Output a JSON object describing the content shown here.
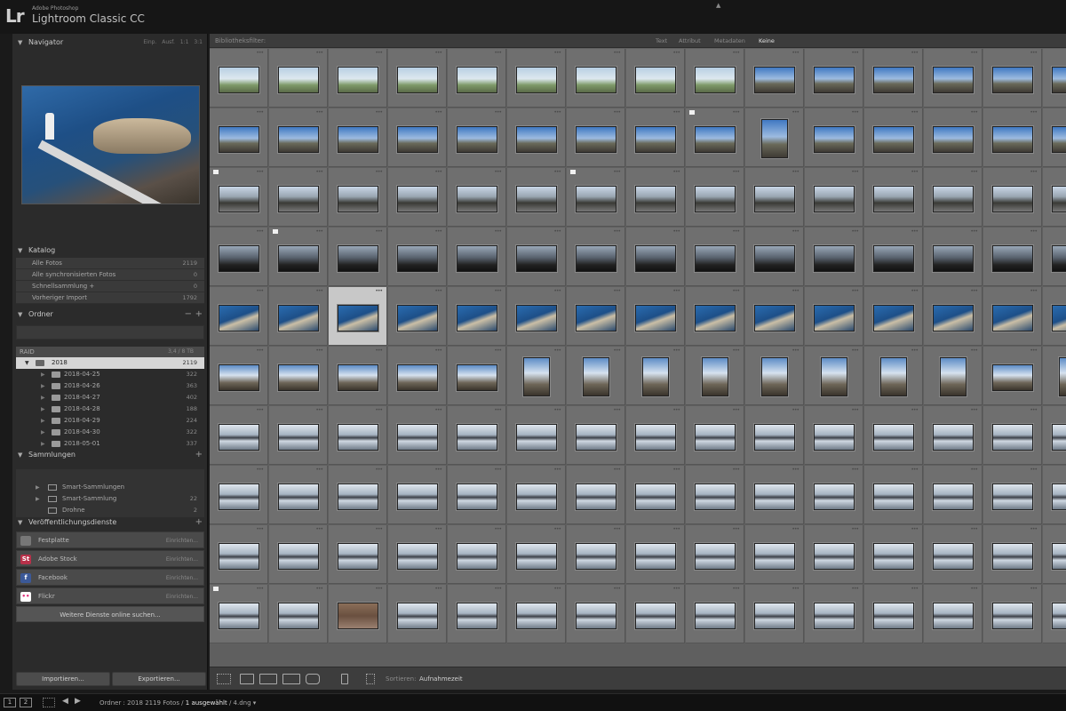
{
  "app": {
    "logo": "Lr",
    "brand_small": "Adobe Photoshop",
    "brand_title": "Lightroom Classic CC"
  },
  "navigator": {
    "title": "Navigator",
    "options": "Einp. Ausf. 1:1 3:1"
  },
  "catalog": {
    "title": "Katalog",
    "rows": [
      {
        "label": "Alle Fotos",
        "count": "2119"
      },
      {
        "label": "Alle synchronisierten Fotos",
        "count": "0"
      },
      {
        "label": "Schnellsammlung +",
        "count": "0"
      },
      {
        "label": "Vorheriger Import",
        "count": "1792"
      }
    ]
  },
  "folders": {
    "title": "Ordner",
    "volume": "RAID",
    "volume_info": "3,4 / 8 TB",
    "root": {
      "label": "2018",
      "count": "2119"
    },
    "items": [
      {
        "label": "2018-04-25",
        "count": "322"
      },
      {
        "label": "2018-04-26",
        "count": "363"
      },
      {
        "label": "2018-04-27",
        "count": "402"
      },
      {
        "label": "2018-04-28",
        "count": "188"
      },
      {
        "label": "2018-04-29",
        "count": "224"
      },
      {
        "label": "2018-04-30",
        "count": "322"
      },
      {
        "label": "2018-05-01",
        "count": "337"
      }
    ]
  },
  "collections": {
    "title": "Sammlungen",
    "items": [
      {
        "label": "Smart-Sammlungen",
        "count": ""
      },
      {
        "label": "Smart-Sammlung",
        "count": "22"
      },
      {
        "label": "Drohne",
        "count": "2"
      }
    ]
  },
  "publish": {
    "title": "Veröffentlichungsdienste",
    "services": [
      {
        "label": "Festplatte",
        "setup": "Einrichten...",
        "icon_color": "#777777",
        "icon_glyph": ""
      },
      {
        "label": "Adobe Stock",
        "setup": "Einrichten...",
        "icon_color": "#b8314a",
        "icon_glyph": "St"
      },
      {
        "label": "Facebook",
        "setup": "Einrichten...",
        "icon_color": "#3b5998",
        "icon_glyph": "f"
      },
      {
        "label": "Flickr",
        "setup": "Einrichten...",
        "icon_color": "#ffffff",
        "icon_glyph": "••"
      }
    ],
    "more": "Weitere Dienste online suchen..."
  },
  "buttons": {
    "import": "Importieren...",
    "export": "Exportieren..."
  },
  "filter_bar": {
    "title": "Bibliotheksfilter:",
    "tabs": [
      "Text",
      "Attribut",
      "Metadaten",
      "Keine"
    ],
    "active": "Keine"
  },
  "toolbar": {
    "sort_label": "Sortieren:",
    "sort_value": "Aufnahmezeit"
  },
  "filmstrip": {
    "screen1": "1",
    "screen2": "2",
    "source_prefix": "Ordner : 2018",
    "source_count": "2119 Fotos /",
    "source_selected": "1 ausgewählt",
    "source_file": "/ 4.dng"
  },
  "grid": {
    "columns": 15,
    "rows": 10,
    "selected_cell": "4-2",
    "flagged_cells": [
      "1-8",
      "2-0",
      "2-6",
      "3-1",
      "9-0"
    ],
    "row_kinds": [
      "coast",
      "coast-road",
      "road",
      "dark",
      "pier",
      "pier-portrait",
      "lake",
      "lake",
      "lake",
      "lake"
    ]
  }
}
